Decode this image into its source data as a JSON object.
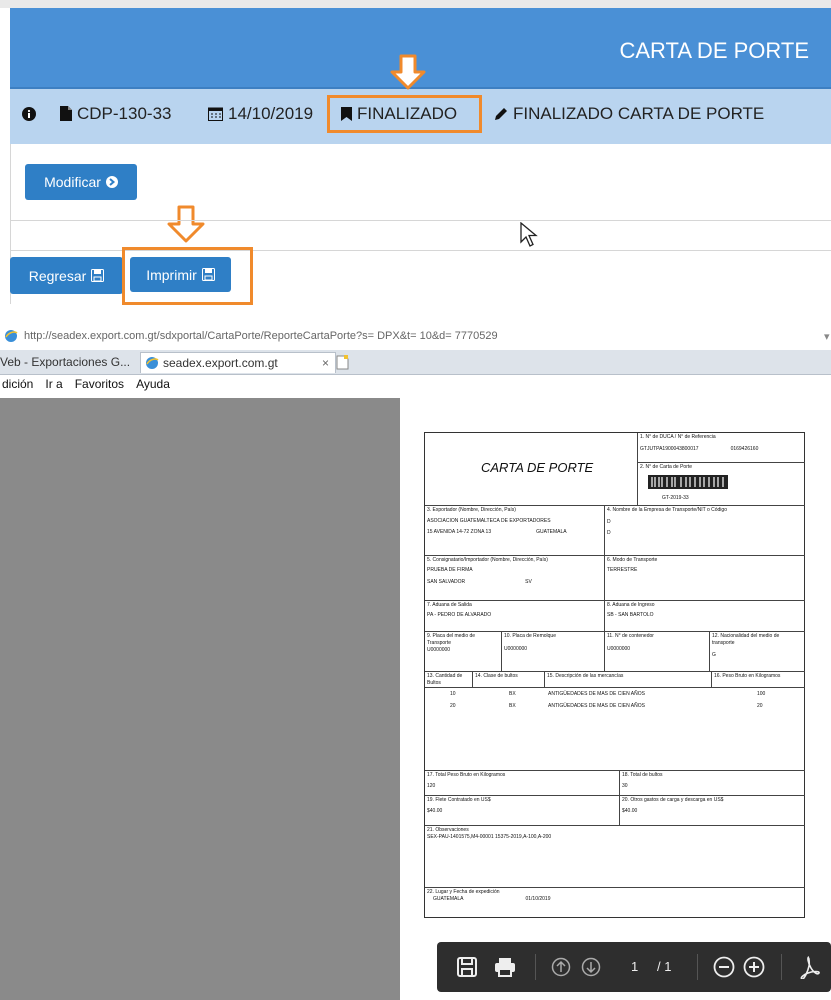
{
  "app": {
    "title": "CARTA DE PORTE",
    "info": {
      "doc_id": "CDP-130-33",
      "date": "14/10/2019",
      "status": "FINALIZADO",
      "status_detail": "FINALIZADO CARTA DE PORTE"
    },
    "buttons": {
      "modify": "Modificar",
      "back": "Regresar",
      "print": "Imprimir"
    }
  },
  "browser": {
    "url": "http://seadex.export.com.gt/sdxportal/CartaPorte/ReporteCartaPorte?s= DPX&t= 10&d= 7770529",
    "tabs": [
      "Veb - Exportaciones G...",
      "seadex.export.com.gt"
    ],
    "menu": [
      "dición",
      "Ir a",
      "Favoritos",
      "Ayuda"
    ]
  },
  "doc": {
    "title": "CARTA DE PORTE",
    "f1_label": "1. N° de DUCA / N° de Referencia",
    "f1_value": "GTJUTPA1900043800017",
    "f1_value2": "0169426160",
    "f2_label": "2. N° de Carta de Porte",
    "f2_value": "GT-2019-33",
    "f3_label": "3. Exportador (Nombre, Dirección, País)",
    "f3_l1": "ASOCIACION GUATEMALTECA DE EXPORTADORES",
    "f3_l2": "15 AVENIDA 14-72 ZONA 13",
    "f3_l3": "GUATEMALA",
    "f4_label": "4. Nombre de la Empresa de Transporte/NIT o Código",
    "f4_l1": "D",
    "f4_l2": "D",
    "f5_label": "5. Consignatario/Importador (Nombre, Dirección, País)",
    "f5_l1": "PRUEBA DE FIRMA",
    "f5_l2": "SAN SALVADOR",
    "f5_l3": "SV",
    "f6_label": "6. Modo de Transporte",
    "f6_value": "TERRESTRE",
    "f7_label": "7. Aduana de Salida",
    "f7_value": "PA - PEDRO DE ALVARADO",
    "f8_label": "8. Aduana de Ingreso",
    "f8_value": "SB - SAN BARTOLO",
    "f9_label": "9. Placa del medio de Transporte",
    "f9_value": "U0000000",
    "f10_label": "10. Placa de Remolque",
    "f10_value": "U0000000",
    "f11_label": "11. N° de contenedor",
    "f11_value": "U0000000",
    "f12_label": "12. Nacionalidad del medio de transporte",
    "f12_value": "G",
    "f13_label": "13. Cantidad de Bultos",
    "f14_label": "14. Clase de bultos",
    "f15_label": "15. Descripción de las mercancías",
    "f16_label": "16. Peso Bruto en Kilogramos",
    "items": [
      {
        "qty": "10",
        "kind": "BX",
        "desc": "ANTIGÜEDADES DE MAS DE CIEN AÑOS",
        "weight": "100"
      },
      {
        "qty": "20",
        "kind": "BX",
        "desc": "ANTIGÜEDADES DE MAS DE CIEN AÑOS",
        "weight": "20"
      }
    ],
    "f17_label": "17. Total Peso Bruto en Kilogramos",
    "f17_value": "120",
    "f18_label": "18. Total de bultos",
    "f18_value": "30",
    "f19_label": "19. Flete Contratado en US$",
    "f19_value": "$40.00",
    "f20_label": "20. Otros gastos de carga y descarga en US$",
    "f20_value": "$40.00",
    "f21_label": "21. Observaciones",
    "f21_value": "SEX-PAU-1401575,M4-00001 15375-2019,A-100,A-200",
    "f22_label": "22. Lugar y Fecha de expedición",
    "f22_place": "GUATEMALA",
    "f22_date": "01/10/2019"
  },
  "pdf": {
    "page": "1",
    "total": "/ 1"
  },
  "colors": {
    "header": "#4a90d6",
    "infobar": "#b9d4ef",
    "button": "#2f7fc6",
    "highlight": "#f08a2c"
  }
}
